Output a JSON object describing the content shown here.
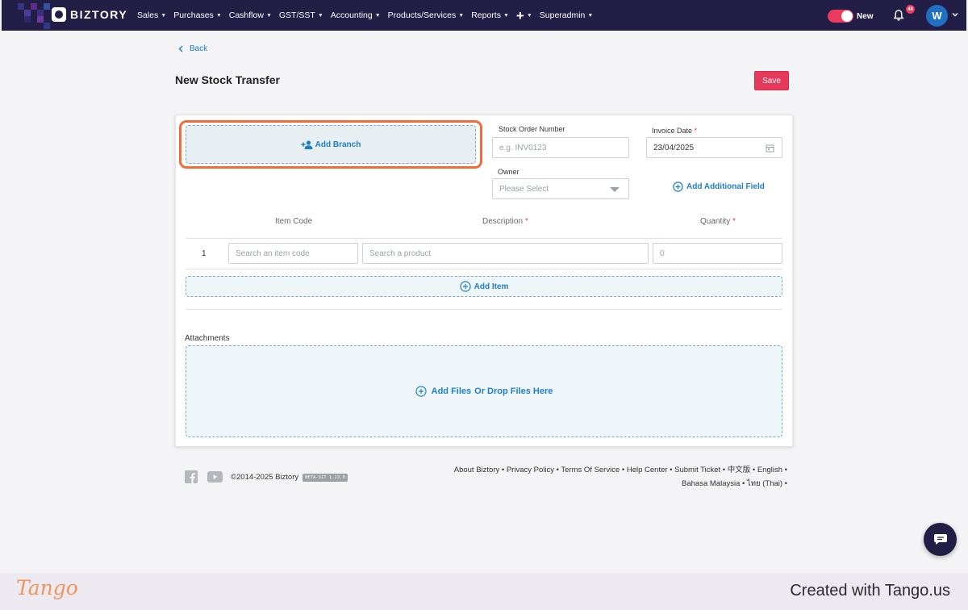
{
  "nav": {
    "brand": "BIZTORY",
    "menu": [
      "Sales",
      "Purchases",
      "Cashflow",
      "GST/SST",
      "Accounting",
      "Products/Services",
      "Reports",
      "+",
      "Superadmin"
    ],
    "toggle_label": "New",
    "notification_count": "48",
    "avatar_initial": "W",
    "colors": {
      "bar": "#221e46",
      "toggle": "#e83b5d",
      "avatar": "#1f6fc2"
    }
  },
  "page": {
    "back_label": "Back",
    "title": "New Stock Transfer",
    "save_label": "Save"
  },
  "form": {
    "add_branch_label": "Add Branch",
    "stock_order_label": "Stock Order Number",
    "stock_order_placeholder": "e.g. INV0123",
    "invoice_date_label": "Invoice Date",
    "invoice_date_value": "23/04/2025",
    "required_mark": "*",
    "owner_label": "Owner",
    "owner_value": "Please Select",
    "add_field_label": "Add Additional Field"
  },
  "items_table": {
    "headers": {
      "item_code": "Item Code",
      "description": "Description",
      "quantity": "Quantity"
    },
    "rows": [
      {
        "num": "1",
        "item_code_placeholder": "Search an item code",
        "product_placeholder": "Search a product",
        "quantity_placeholder": "0"
      }
    ],
    "add_item_label": "Add Item"
  },
  "attachments": {
    "label": "Attachments",
    "add_files": "Add Files",
    "drop_files": "Or Drop Files Here"
  },
  "footer": {
    "copyright": "©2014-2025 Biztory",
    "version": "BETA-SIT 1.13.0",
    "links_line1": "About Biztory • Privacy Policy • Terms Of Service • Help Center • Submit Ticket • 中文版 • English •",
    "links_line2": "Bahasa Malaysia • ไทย (Thai) •"
  },
  "tango": {
    "logo": "Tango",
    "created_with": "Created with Tango.us"
  }
}
